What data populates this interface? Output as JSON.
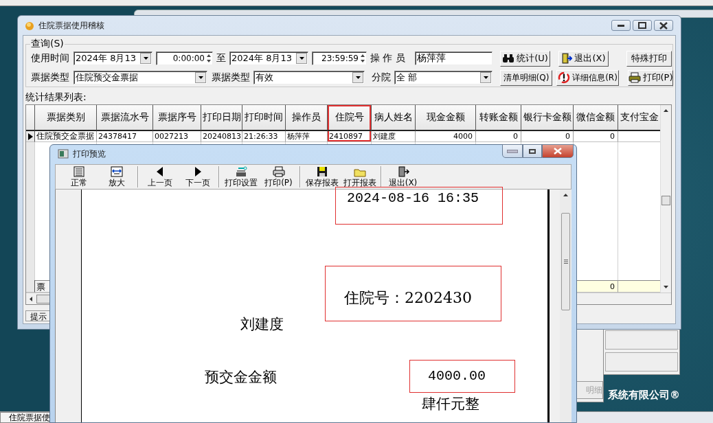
{
  "main_window": {
    "title": "住院票据使用稽核",
    "query": {
      "title": "查询(S)",
      "time_label": "使用时间",
      "start_date": "2024年 8月13",
      "start_time": "0:00:00",
      "to_label": "至",
      "end_date": "2024年 8月13",
      "end_time": "23:59:59",
      "operator_label": "操 作 员",
      "operator": "杨萍萍",
      "bill_type_label": "票据类型",
      "bill_type": "住院预交金票据",
      "status_label": "票据类型",
      "status": "有效",
      "branch_label": "分院",
      "branch": "全 部",
      "buttons": [
        "统计(U)",
        "退出(X)",
        "特殊打印",
        "清单明细(Q)",
        "详细信息(R)",
        "打印(P)"
      ]
    },
    "results_label": "统计结果列表:",
    "table": {
      "columns": [
        {
          "label": "票据类别",
          "highlighted": false
        },
        {
          "label": "票据流水号",
          "highlighted": false
        },
        {
          "label": "票据序号",
          "highlighted": false
        },
        {
          "label": "打印日期",
          "highlighted": false
        },
        {
          "label": "打印时间",
          "highlighted": false
        },
        {
          "label": "操作员",
          "highlighted": false
        },
        {
          "label": "住院号",
          "highlighted": true
        },
        {
          "label": "病人姓名",
          "highlighted": false
        },
        {
          "label": "现金金额",
          "highlighted": false
        },
        {
          "label": "转账金额",
          "highlighted": false
        },
        {
          "label": "银行卡金额",
          "highlighted": false
        },
        {
          "label": "微信金额",
          "highlighted": false
        },
        {
          "label": "支付宝金",
          "highlighted": false
        }
      ],
      "rows": [
        {
          "current": true,
          "cells": [
            "住院预交金票据",
            "24378417",
            "0027213",
            "20240813",
            "21:26:33",
            "杨萍萍",
            "2410897",
            "刘建度",
            "4000",
            "0",
            "0",
            "0"
          ]
        }
      ],
      "footer": {
        "label": "票",
        "wechat_total": "0"
      }
    },
    "status_bar": "提示"
  },
  "preview_window": {
    "title": "打印预览",
    "toolbar": [
      "正常",
      "放大",
      "上一页",
      "下一页",
      "打印设置",
      "打印(P)",
      "保存报表",
      "打开报表",
      "退出(X)"
    ],
    "page_texts": [
      {
        "text": "2024-08-16 16:35",
        "boxed": true
      },
      {
        "text": "住院号：2202430",
        "boxed": true
      },
      {
        "text": "刘建度",
        "boxed": false
      },
      {
        "text": "预交金金额",
        "boxed": false
      },
      {
        "text": "4000.00",
        "boxed": true
      },
      {
        "text": "肆仟元整",
        "boxed": false
      }
    ]
  },
  "background_window": {
    "buttons": [
      {
        "label": "明细",
        "disabled": true
      }
    ]
  },
  "background_text": "系统有限公司®",
  "taskbar": {
    "tasks": [
      "住院票据使"
    ]
  }
}
